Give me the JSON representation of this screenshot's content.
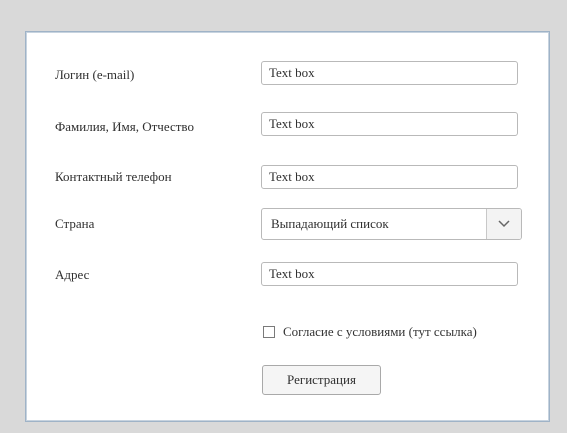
{
  "form": {
    "login_label": "Логин (e-mail)",
    "login_value": "Text box",
    "fio_label": "Фамилия, Имя, Отчество",
    "fio_value": "Text box",
    "phone_label": "Контактный телефон",
    "phone_value": "Text box",
    "country_label": "Страна",
    "country_value": "Выпадающий список",
    "address_label": "Адрес",
    "address_value": "Text box",
    "agree_label": "Согласие с условиями (тут ссылка)",
    "agree_checked": false,
    "submit_label": "Регистрация"
  },
  "icons": {
    "select_arrow": "chevron-down-icon"
  }
}
